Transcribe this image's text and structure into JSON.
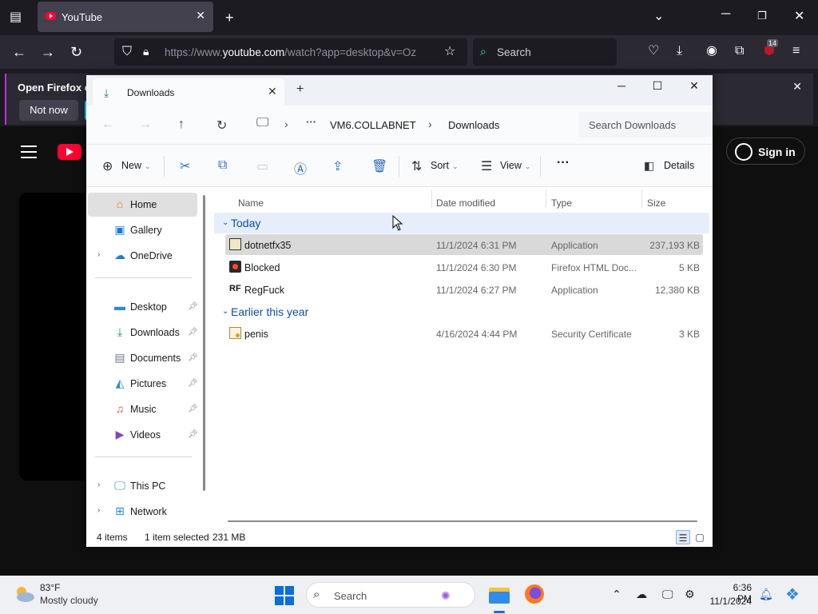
{
  "browser": {
    "tab": {
      "title": "YouTube"
    },
    "url": {
      "prefix": "https://www.",
      "host": "youtube.com",
      "path": "/watch?app=desktop&v=Oz"
    },
    "search": {
      "placeholder": "Search"
    },
    "extension_badge": "14",
    "notice": {
      "text": "Open Firefox ev",
      "dismiss_label": "Not now"
    }
  },
  "youtube": {
    "sign_in_label": "Sign in"
  },
  "explorer": {
    "tab_title": "Downloads",
    "breadcrumb": {
      "more": "···",
      "host": "VM6.COLLABNET",
      "current": "Downloads"
    },
    "search_placeholder": "Search Downloads",
    "toolbar": {
      "new_label": "New",
      "sort_label": "Sort",
      "view_label": "View",
      "more_label": "···",
      "details_label": "Details"
    },
    "sidebar": {
      "items": [
        {
          "label": "Home",
          "icon": "home-icon",
          "selected": true
        },
        {
          "label": "Gallery",
          "icon": "gallery-icon"
        },
        {
          "label": "OneDrive",
          "icon": "cloud-icon"
        },
        {
          "label": "Desktop",
          "icon": "desktop-icon",
          "pinned": true
        },
        {
          "label": "Downloads",
          "icon": "download-icon",
          "pinned": true
        },
        {
          "label": "Documents",
          "icon": "document-icon",
          "pinned": true
        },
        {
          "label": "Pictures",
          "icon": "pictures-icon",
          "pinned": true
        },
        {
          "label": "Music",
          "icon": "music-icon",
          "pinned": true
        },
        {
          "label": "Videos",
          "icon": "videos-icon",
          "pinned": true
        },
        {
          "label": "This PC",
          "icon": "pc-icon"
        },
        {
          "label": "Network",
          "icon": "network-icon"
        }
      ]
    },
    "columns": {
      "name": "Name",
      "date": "Date modified",
      "type": "Type",
      "size": "Size"
    },
    "groups": [
      {
        "label": "Today",
        "files": [
          {
            "name": "dotnetfx35",
            "date": "11/1/2024 6:31 PM",
            "type": "Application",
            "size": "237,193 KB",
            "selected": true
          },
          {
            "name": "Blocked",
            "date": "11/1/2024 6:30 PM",
            "type": "Firefox HTML Doc...",
            "size": "5 KB"
          },
          {
            "name": "RegFuck",
            "date": "11/1/2024 6:27 PM",
            "type": "Application",
            "size": "12,380 KB"
          }
        ]
      },
      {
        "label": "Earlier this year",
        "files": [
          {
            "name": "penis",
            "date": "4/16/2024 4:44 PM",
            "type": "Security Certificate",
            "size": "3 KB"
          }
        ]
      }
    ],
    "status": {
      "count": "4 items",
      "selection": "1 item selected",
      "size": "231 MB"
    }
  },
  "taskbar": {
    "weather": {
      "temp": "83°F",
      "desc": "Mostly cloudy"
    },
    "search_label": "Search",
    "clock": {
      "time": "6:36 PM",
      "date": "11/1/2024"
    }
  }
}
